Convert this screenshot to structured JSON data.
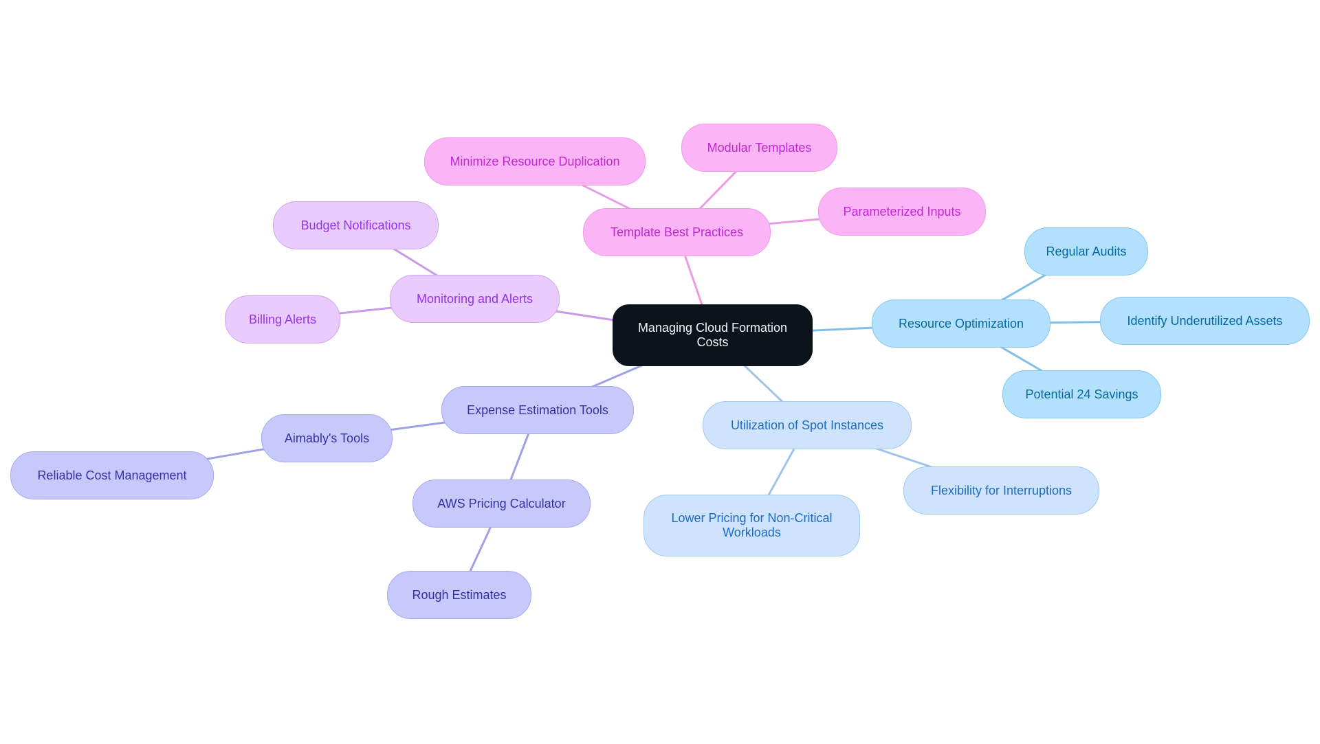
{
  "diagram": {
    "type": "mindmap",
    "root": {
      "id": "root",
      "label": "Managing Cloud Formation Costs",
      "theme": "root"
    },
    "themes": {
      "root": {
        "fill": "#0d131a",
        "stroke": "#0d131a",
        "text": "#f3f4f6",
        "line": "#0d131a"
      },
      "pink": {
        "fill": "#fbb4f5",
        "stroke": "#f09ae8",
        "text": "#c026d3",
        "line": "#e99be6"
      },
      "violet": {
        "fill": "#e9ccfd",
        "stroke": "#cfa4ef",
        "text": "#9333ea",
        "line": "#c99ae8"
      },
      "indigo": {
        "fill": "#c7c9fb",
        "stroke": "#a5a8ef",
        "text": "#3730a3",
        "line": "#9ea0e6"
      },
      "sky": {
        "fill": "#b3e0fc",
        "stroke": "#86c6ee",
        "text": "#0369a1",
        "line": "#7fbfe8"
      },
      "azure": {
        "fill": "#cfe4fc",
        "stroke": "#a2c8f0",
        "text": "#1d6bc1",
        "line": "#9ec4ec"
      }
    },
    "nodes": [
      {
        "id": "template-best-practices",
        "label": "Template Best Practices",
        "parent": "root",
        "theme": "pink"
      },
      {
        "id": "minimize-resource-duplication",
        "label": "Minimize Resource Duplication",
        "parent": "template-best-practices",
        "theme": "pink"
      },
      {
        "id": "modular-templates",
        "label": "Modular Templates",
        "parent": "template-best-practices",
        "theme": "pink"
      },
      {
        "id": "parameterized-inputs",
        "label": "Parameterized Inputs",
        "parent": "template-best-practices",
        "theme": "pink"
      },
      {
        "id": "monitoring-and-alerts",
        "label": "Monitoring and Alerts",
        "parent": "root",
        "theme": "violet"
      },
      {
        "id": "budget-notifications",
        "label": "Budget Notifications",
        "parent": "monitoring-and-alerts",
        "theme": "violet"
      },
      {
        "id": "billing-alerts",
        "label": "Billing Alerts",
        "parent": "monitoring-and-alerts",
        "theme": "violet"
      },
      {
        "id": "expense-estimation-tools",
        "label": "Expense Estimation Tools",
        "parent": "root",
        "theme": "indigo"
      },
      {
        "id": "aimablys-tools",
        "label": "Aimably's Tools",
        "parent": "expense-estimation-tools",
        "theme": "indigo"
      },
      {
        "id": "reliable-cost-management",
        "label": "Reliable Cost Management",
        "parent": "aimablys-tools",
        "theme": "indigo"
      },
      {
        "id": "aws-pricing-calculator",
        "label": "AWS Pricing Calculator",
        "parent": "expense-estimation-tools",
        "theme": "indigo"
      },
      {
        "id": "rough-estimates",
        "label": "Rough Estimates",
        "parent": "aws-pricing-calculator",
        "theme": "indigo"
      },
      {
        "id": "resource-optimization",
        "label": "Resource Optimization",
        "parent": "root",
        "theme": "sky"
      },
      {
        "id": "regular-audits",
        "label": "Regular Audits",
        "parent": "resource-optimization",
        "theme": "sky"
      },
      {
        "id": "identify-underutilized-assets",
        "label": "Identify Underutilized Assets",
        "parent": "resource-optimization",
        "theme": "sky"
      },
      {
        "id": "potential-24-savings",
        "label": "Potential 24 Savings",
        "parent": "resource-optimization",
        "theme": "sky"
      },
      {
        "id": "utilization-of-spot-instances",
        "label": "Utilization of Spot Instances",
        "parent": "root",
        "theme": "azure"
      },
      {
        "id": "lower-pricing-non-critical",
        "label": "Lower Pricing for Non-Critical Workloads",
        "parent": "utilization-of-spot-instances",
        "theme": "azure"
      },
      {
        "id": "flexibility-for-interruptions",
        "label": "Flexibility for Interruptions",
        "parent": "utilization-of-spot-instances",
        "theme": "azure"
      }
    ]
  }
}
